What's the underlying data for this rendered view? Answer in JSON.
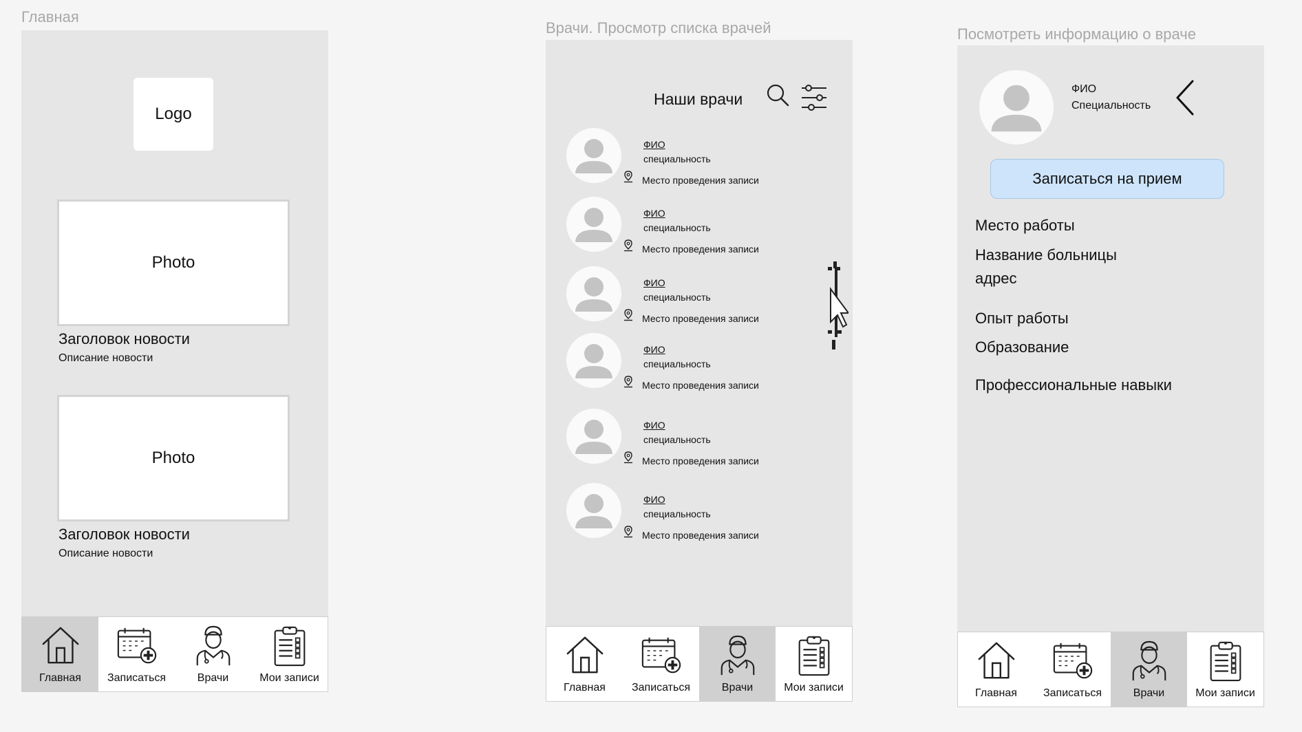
{
  "frames": {
    "home_title": "Главная",
    "doctors_title": "Врачи. Просмотр списка врачей",
    "detail_title": "Посмотреть информацию о враче"
  },
  "nav": {
    "home": "Главная",
    "book": "Записаться",
    "doctors": "Врачи",
    "records": "Мои записи"
  },
  "home": {
    "logo": "Logo",
    "news": [
      {
        "photo": "Photo",
        "title": "Заголовок новости",
        "desc": "Описание новости"
      },
      {
        "photo": "Photo",
        "title": "Заголовок новости",
        "desc": "Описание новости"
      }
    ],
    "active_tab": "Главная"
  },
  "doctors": {
    "title": "Наши врачи",
    "items": [
      {
        "name": "ФИО",
        "specialty": "специальность",
        "place": "Место проведения записи"
      },
      {
        "name": "ФИО",
        "specialty": "специальность",
        "place": "Место проведения записи"
      },
      {
        "name": "ФИО",
        "specialty": "специальность",
        "place": "Место проведения записи"
      },
      {
        "name": "ФИО",
        "specialty": "специальность",
        "place": "Место проведения записи"
      },
      {
        "name": "ФИО",
        "specialty": "специальность",
        "place": "Место проведения записи"
      },
      {
        "name": "ФИО",
        "specialty": "специальность",
        "place": "Место проведения записи"
      }
    ],
    "active_tab": "Врачи"
  },
  "detail": {
    "name": "ФИО",
    "specialty": "Специальность",
    "book_button": "Записаться на прием",
    "workplace_label": "Место работы",
    "hospital_name": "Название больницы",
    "address": "адрес",
    "experience_label": "Опыт работы",
    "education_label": "Образование",
    "skills_label": "Профессиональные навыки",
    "active_tab": "Врачи"
  },
  "icons": {
    "home": "home-icon",
    "book": "calendar-plus-icon",
    "doctors": "doctor-icon",
    "records": "clipboard-list-icon",
    "search": "search-icon",
    "filter": "filter-sliders-icon",
    "back": "chevron-left-icon",
    "pin": "map-pin-icon",
    "avatar": "avatar-placeholder-icon"
  },
  "colors": {
    "page_bg": "#f5f5f5",
    "phone_bg": "#e6e6e6",
    "active_tab_bg": "#d0d0d0",
    "button_bg": "#cde4fa",
    "frame_title": "#a8a8a8"
  }
}
